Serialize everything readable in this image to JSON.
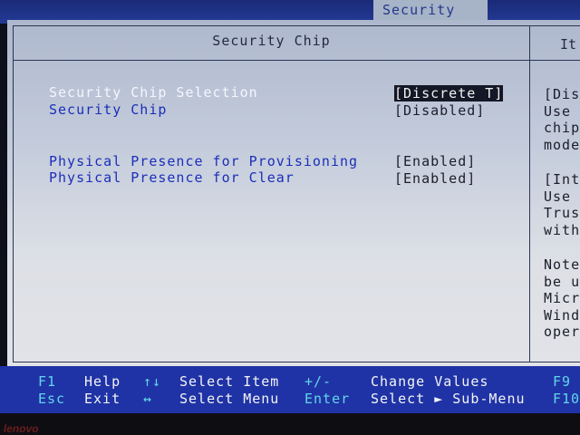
{
  "top_tab": "Security",
  "panel_title": "Security Chip",
  "help_title": "It",
  "settings": [
    {
      "label": "Security Chip Selection",
      "value": "[Discrete T]"
    },
    {
      "label": "Security Chip",
      "value": "[Disabled]"
    },
    {
      "label": "Physical Presence for Provisioning",
      "value": "[Enabled]"
    },
    {
      "label": "Physical Presence for Clear",
      "value": "[Enabled]"
    }
  ],
  "help_text": [
    "[Dis\nUse\nchip\nmode",
    "[Int\nUse\nTrus\nwith",
    "Note\nbe u\nMicr\nWind\noper"
  ],
  "footer": {
    "row1": [
      {
        "key": "F1",
        "text": "Help"
      },
      {
        "key": "↑↓",
        "text": "Select Item"
      },
      {
        "key": "+/-",
        "text": "Change Values"
      },
      {
        "key": "F9",
        "text": ""
      }
    ],
    "row2": [
      {
        "key": "Esc",
        "text": "Exit"
      },
      {
        "key": "↔",
        "text": "Select Menu"
      },
      {
        "key": "Enter",
        "text": "Select ► Sub-Menu"
      },
      {
        "key": "F10",
        "text": ""
      }
    ]
  },
  "logo": "lenovo",
  "colors": {
    "background": "#bfc8d9",
    "label": "#1b2fb8",
    "footer": "#1f33a6",
    "footer_key": "#62d5e8"
  }
}
